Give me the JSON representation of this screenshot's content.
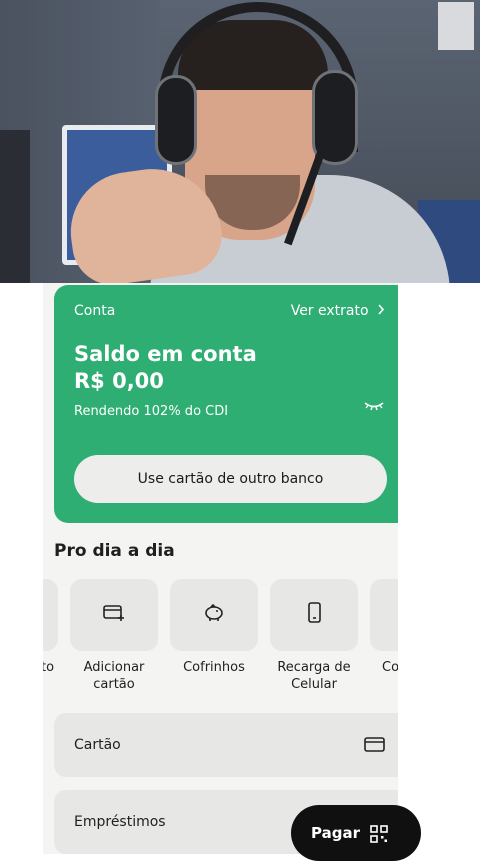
{
  "account_card": {
    "label": "Conta",
    "statement_link": "Ver extrato",
    "balance_title": "Saldo em conta",
    "balance_value": "R$ 0,00",
    "yield_text": "Rendendo 102% do CDI",
    "other_bank_button": "Use cartão de outro banco",
    "accent_color": "#2fae73"
  },
  "section": {
    "title": "Pro dia a dia"
  },
  "shortcuts": [
    {
      "label": "to",
      "icon": "unknown-icon"
    },
    {
      "label": "Adicionar cartão",
      "icon": "card-add-icon"
    },
    {
      "label": "Cofrinhos",
      "icon": "piggy-bank-icon"
    },
    {
      "label": "Recarga de Celular",
      "icon": "phone-icon"
    },
    {
      "label": "Co tra",
      "icon": "unknown-icon"
    }
  ],
  "rows": [
    {
      "label": "Cartão",
      "icon": "credit-card-icon"
    },
    {
      "label": "Empréstimos",
      "icon": "none"
    }
  ],
  "pay_button": {
    "label": "Pagar",
    "icon": "qr-code-icon"
  }
}
